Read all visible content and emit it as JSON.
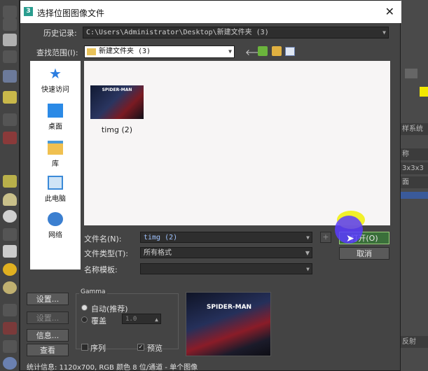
{
  "dialog": {
    "title": "选择位图图像文件",
    "title_icon": "3",
    "close_glyph": "✕",
    "history_label": "历史记录:",
    "history_value": "C:\\Users\\Administrator\\Desktop\\新建文件夹 (3)",
    "lookin_label": "查找范围(I):",
    "lookin_value": "新建文件夹 (3)",
    "filename_label": "文件名(N):",
    "filename_value": "timg (2)",
    "filetype_label": "文件类型(T):",
    "filetype_value": "所有格式",
    "template_label": "名称模板:",
    "template_value": "",
    "open_button": "打开(O)",
    "cancel_button": "取消",
    "plus_button": "+",
    "setup_button": "设置...",
    "setup2_button": "设置...",
    "info_button": "信息...",
    "view_button": "查看",
    "gamma_title": "Gamma",
    "gamma_auto": "自动(推荐)",
    "gamma_override": "覆盖",
    "gamma_value": "1.0",
    "sequence_label": "序列",
    "preview_label": "预览",
    "preview_checked": true,
    "stats": "统计信息:  1120x700, RGB 颜色 8 位/通道 - 单个图像"
  },
  "places": [
    {
      "label": "快速访问",
      "icon": "star-icon"
    },
    {
      "label": "桌面",
      "icon": "desktop-icon"
    },
    {
      "label": "库",
      "icon": "library-icon"
    },
    {
      "label": "此电脑",
      "icon": "computer-icon"
    },
    {
      "label": "网络",
      "icon": "network-icon"
    }
  ],
  "files": [
    {
      "name": "timg (2)",
      "thumb_text": "SPIDER-MAN"
    }
  ],
  "preview_text": "SPIDER-MAN",
  "right_panel": {
    "rows": [
      "样系统",
      "称",
      "3x3x3",
      "面",
      "反射"
    ]
  },
  "colors": {
    "dialog_bg": "#444444",
    "open_button_bg": "#3a6f3a",
    "accent_yellow": "#f0f014",
    "cursor_highlight": "#5a3cff"
  }
}
